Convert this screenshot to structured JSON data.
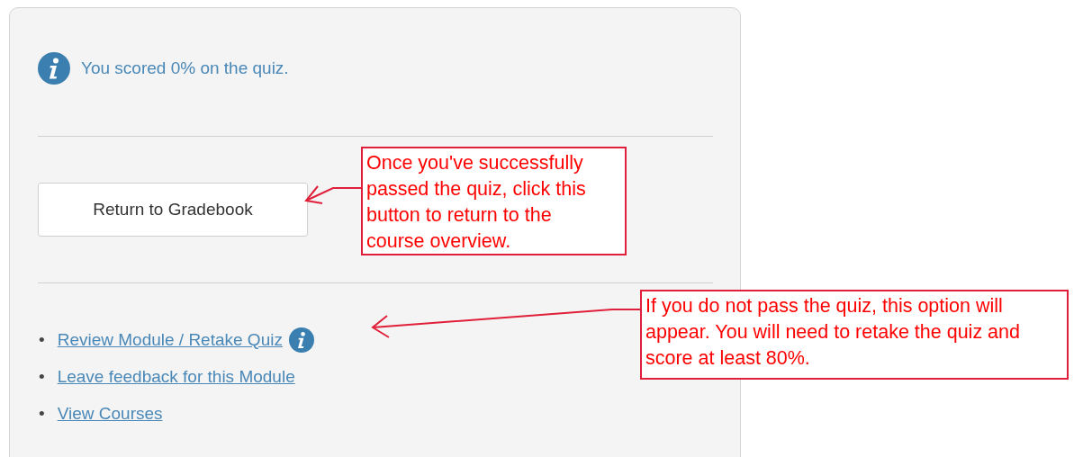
{
  "result": {
    "message": "You scored 0% on the quiz."
  },
  "primary_button": "Return to Gradebook",
  "links": [
    {
      "bullet": "•",
      "label": "Review Module / Retake Quiz",
      "info": true
    },
    {
      "bullet": "•",
      "label": "Leave feedback for this Module",
      "info": false
    },
    {
      "bullet": "•",
      "label": "View Courses",
      "info": false
    }
  ],
  "annotations": [
    {
      "text": "Once you've successfully passed the quiz, click this button to return to the course overview."
    },
    {
      "text": "If you do not pass the quiz, this option will appear. You will need to retake the quiz and score at least 80%."
    }
  ]
}
